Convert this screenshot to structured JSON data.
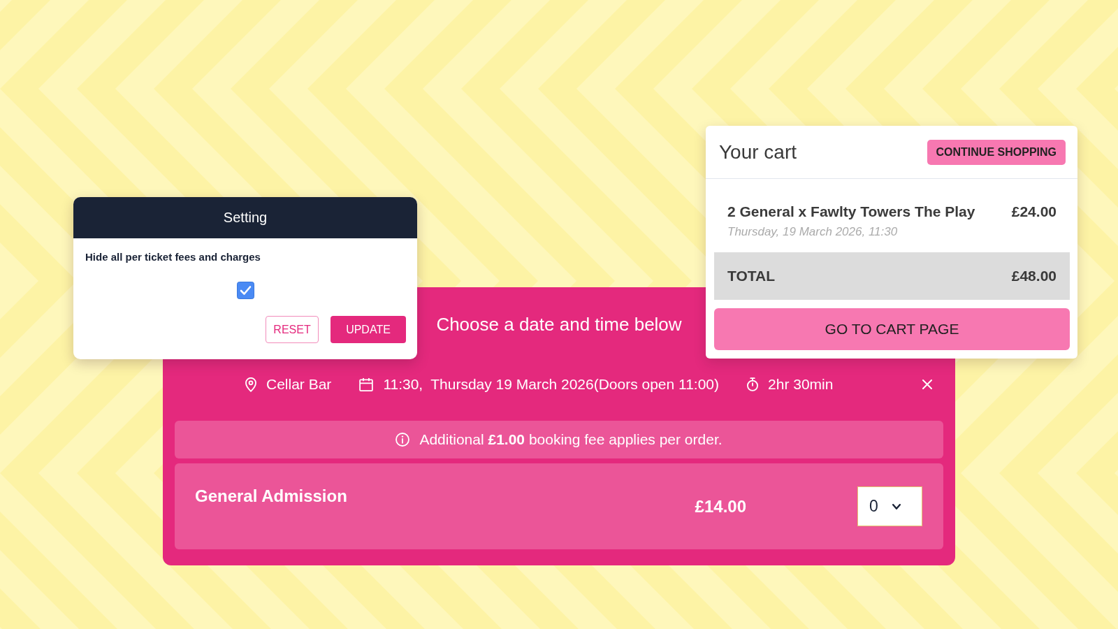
{
  "settings_dialog": {
    "title": "Setting",
    "option": {
      "label": "Hide all per ticket fees and charges",
      "checked": true
    },
    "buttons": [
      {
        "label": "RESET",
        "kind": "outline"
      },
      {
        "label": "UPDATE",
        "kind": "primary"
      }
    ]
  },
  "event_panel": {
    "heading": "Choose a date and time below",
    "details": [
      {
        "kind": "location",
        "text": "Cellar Bar"
      },
      {
        "kind": "datetime",
        "time": "11:30,",
        "date": "Thursday 19 March 2026(Doors open 11:00)"
      },
      {
        "kind": "duration",
        "text": "2hr 30min"
      }
    ],
    "notice": "Additional **£1.00** booking fee applies per order.",
    "tickets": [
      {
        "name": "General Admission",
        "price": "£14.00",
        "quantity": "0"
      }
    ]
  },
  "cart": {
    "title": "Your cart",
    "continue_button": "CONTINUE SHOPPING",
    "items": [
      {
        "description": "2 General x Fawlty Towers The Play",
        "date": "Thursday, 19 March 2026, 11:30",
        "price": "£24.00"
      }
    ],
    "total_label": "TOTAL",
    "total": "£48.00",
    "checkout_button": "GO TO CART PAGE"
  }
}
